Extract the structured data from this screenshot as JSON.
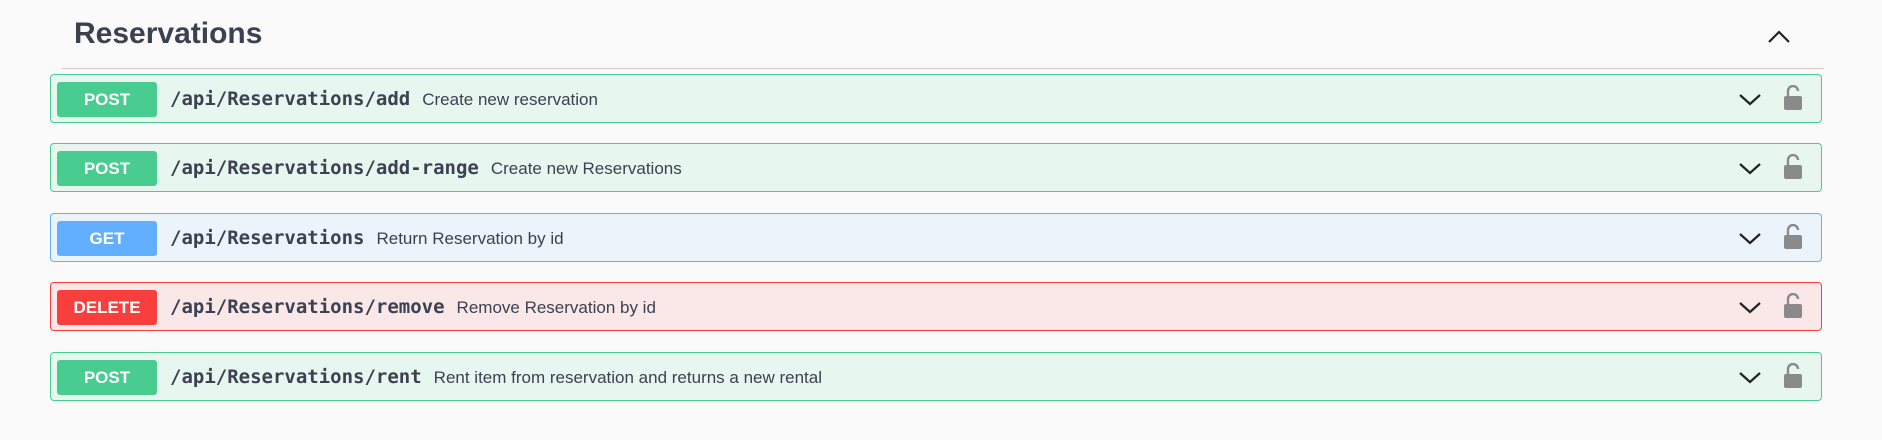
{
  "section": {
    "title": "Reservations"
  },
  "operations": [
    {
      "method": "POST",
      "path": "/api/Reservations/add",
      "summary": "Create new reservation"
    },
    {
      "method": "POST",
      "path": "/api/Reservations/add-range",
      "summary": "Create new Reservations"
    },
    {
      "method": "GET",
      "path": "/api/Reservations",
      "summary": "Return Reservation by id"
    },
    {
      "method": "DELETE",
      "path": "/api/Reservations/remove",
      "summary": "Remove Reservation by id"
    },
    {
      "method": "POST",
      "path": "/api/Reservations/rent",
      "summary": "Rent item from reservation and returns a new rental"
    }
  ],
  "icons": {
    "collapse": "chevron-up-icon",
    "expand": "chevron-down-icon",
    "auth": "unlocked-padlock-icon"
  },
  "colors": {
    "post": "#49cc90",
    "get": "#61affe",
    "delete": "#f93e3e"
  }
}
